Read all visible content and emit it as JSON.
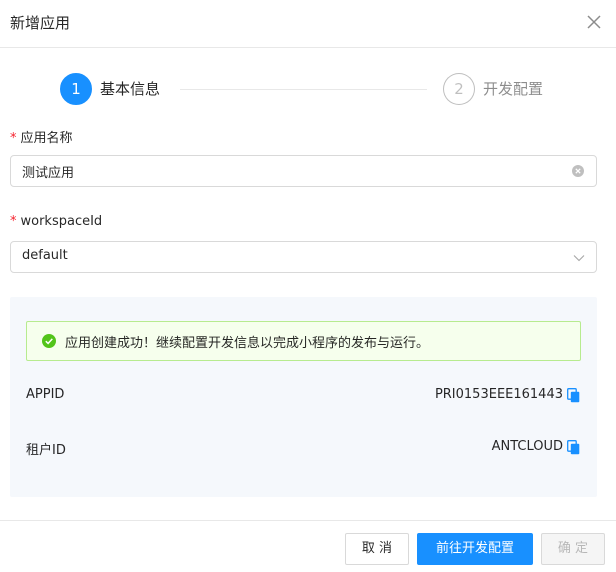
{
  "modal": {
    "title": "新增应用",
    "close_icon": "close-icon"
  },
  "steps": [
    {
      "number": "1",
      "label": "基本信息",
      "status": "active"
    },
    {
      "number": "2",
      "label": "开发配置",
      "status": "wait"
    }
  ],
  "form": {
    "app_name": {
      "required_mark": "*",
      "label": "应用名称",
      "value": "测试应用"
    },
    "workspace": {
      "required_mark": "*",
      "label": "workspaceId",
      "value": "default"
    }
  },
  "panel": {
    "success_message": "应用创建成功！继续配置开发信息以完成小程序的发布与运行。",
    "rows": [
      {
        "label": "APPID",
        "value": "PRI0153EEE161443",
        "icon": "copy-icon"
      },
      {
        "label": "租户ID",
        "value": "ANTCLOUD",
        "icon": "copy-icon"
      }
    ]
  },
  "footer": {
    "cancel_label": "取 消",
    "next_label": "前往开发配置",
    "ok_label": "确 定"
  },
  "colors": {
    "primary": "#1890ff",
    "success": "#52c41a",
    "success_bg": "#f6ffed",
    "success_border": "#b7eb8f",
    "required": "#f5222d",
    "panel_bg": "#f5f8fc"
  }
}
